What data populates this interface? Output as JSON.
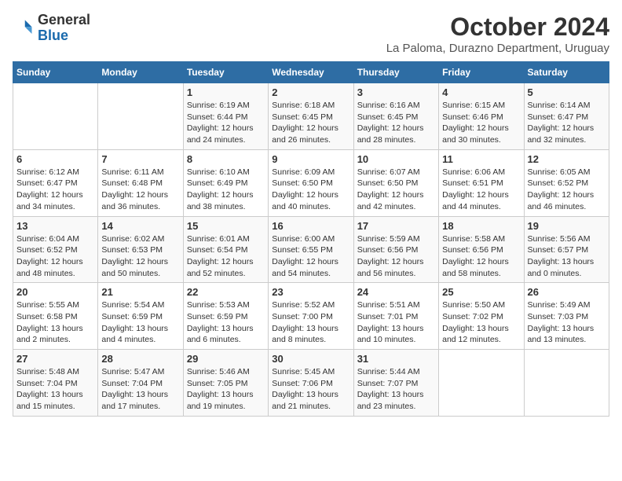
{
  "logo": {
    "general": "General",
    "blue": "Blue"
  },
  "header": {
    "month": "October 2024",
    "location": "La Paloma, Durazno Department, Uruguay"
  },
  "days_of_week": [
    "Sunday",
    "Monday",
    "Tuesday",
    "Wednesday",
    "Thursday",
    "Friday",
    "Saturday"
  ],
  "weeks": [
    [
      {
        "day": "",
        "details": ""
      },
      {
        "day": "",
        "details": ""
      },
      {
        "day": "1",
        "details": "Sunrise: 6:19 AM\nSunset: 6:44 PM\nDaylight: 12 hours and 24 minutes."
      },
      {
        "day": "2",
        "details": "Sunrise: 6:18 AM\nSunset: 6:45 PM\nDaylight: 12 hours and 26 minutes."
      },
      {
        "day": "3",
        "details": "Sunrise: 6:16 AM\nSunset: 6:45 PM\nDaylight: 12 hours and 28 minutes."
      },
      {
        "day": "4",
        "details": "Sunrise: 6:15 AM\nSunset: 6:46 PM\nDaylight: 12 hours and 30 minutes."
      },
      {
        "day": "5",
        "details": "Sunrise: 6:14 AM\nSunset: 6:47 PM\nDaylight: 12 hours and 32 minutes."
      }
    ],
    [
      {
        "day": "6",
        "details": "Sunrise: 6:12 AM\nSunset: 6:47 PM\nDaylight: 12 hours and 34 minutes."
      },
      {
        "day": "7",
        "details": "Sunrise: 6:11 AM\nSunset: 6:48 PM\nDaylight: 12 hours and 36 minutes."
      },
      {
        "day": "8",
        "details": "Sunrise: 6:10 AM\nSunset: 6:49 PM\nDaylight: 12 hours and 38 minutes."
      },
      {
        "day": "9",
        "details": "Sunrise: 6:09 AM\nSunset: 6:50 PM\nDaylight: 12 hours and 40 minutes."
      },
      {
        "day": "10",
        "details": "Sunrise: 6:07 AM\nSunset: 6:50 PM\nDaylight: 12 hours and 42 minutes."
      },
      {
        "day": "11",
        "details": "Sunrise: 6:06 AM\nSunset: 6:51 PM\nDaylight: 12 hours and 44 minutes."
      },
      {
        "day": "12",
        "details": "Sunrise: 6:05 AM\nSunset: 6:52 PM\nDaylight: 12 hours and 46 minutes."
      }
    ],
    [
      {
        "day": "13",
        "details": "Sunrise: 6:04 AM\nSunset: 6:52 PM\nDaylight: 12 hours and 48 minutes."
      },
      {
        "day": "14",
        "details": "Sunrise: 6:02 AM\nSunset: 6:53 PM\nDaylight: 12 hours and 50 minutes."
      },
      {
        "day": "15",
        "details": "Sunrise: 6:01 AM\nSunset: 6:54 PM\nDaylight: 12 hours and 52 minutes."
      },
      {
        "day": "16",
        "details": "Sunrise: 6:00 AM\nSunset: 6:55 PM\nDaylight: 12 hours and 54 minutes."
      },
      {
        "day": "17",
        "details": "Sunrise: 5:59 AM\nSunset: 6:56 PM\nDaylight: 12 hours and 56 minutes."
      },
      {
        "day": "18",
        "details": "Sunrise: 5:58 AM\nSunset: 6:56 PM\nDaylight: 12 hours and 58 minutes."
      },
      {
        "day": "19",
        "details": "Sunrise: 5:56 AM\nSunset: 6:57 PM\nDaylight: 13 hours and 0 minutes."
      }
    ],
    [
      {
        "day": "20",
        "details": "Sunrise: 5:55 AM\nSunset: 6:58 PM\nDaylight: 13 hours and 2 minutes."
      },
      {
        "day": "21",
        "details": "Sunrise: 5:54 AM\nSunset: 6:59 PM\nDaylight: 13 hours and 4 minutes."
      },
      {
        "day": "22",
        "details": "Sunrise: 5:53 AM\nSunset: 6:59 PM\nDaylight: 13 hours and 6 minutes."
      },
      {
        "day": "23",
        "details": "Sunrise: 5:52 AM\nSunset: 7:00 PM\nDaylight: 13 hours and 8 minutes."
      },
      {
        "day": "24",
        "details": "Sunrise: 5:51 AM\nSunset: 7:01 PM\nDaylight: 13 hours and 10 minutes."
      },
      {
        "day": "25",
        "details": "Sunrise: 5:50 AM\nSunset: 7:02 PM\nDaylight: 13 hours and 12 minutes."
      },
      {
        "day": "26",
        "details": "Sunrise: 5:49 AM\nSunset: 7:03 PM\nDaylight: 13 hours and 13 minutes."
      }
    ],
    [
      {
        "day": "27",
        "details": "Sunrise: 5:48 AM\nSunset: 7:04 PM\nDaylight: 13 hours and 15 minutes."
      },
      {
        "day": "28",
        "details": "Sunrise: 5:47 AM\nSunset: 7:04 PM\nDaylight: 13 hours and 17 minutes."
      },
      {
        "day": "29",
        "details": "Sunrise: 5:46 AM\nSunset: 7:05 PM\nDaylight: 13 hours and 19 minutes."
      },
      {
        "day": "30",
        "details": "Sunrise: 5:45 AM\nSunset: 7:06 PM\nDaylight: 13 hours and 21 minutes."
      },
      {
        "day": "31",
        "details": "Sunrise: 5:44 AM\nSunset: 7:07 PM\nDaylight: 13 hours and 23 minutes."
      },
      {
        "day": "",
        "details": ""
      },
      {
        "day": "",
        "details": ""
      }
    ]
  ]
}
